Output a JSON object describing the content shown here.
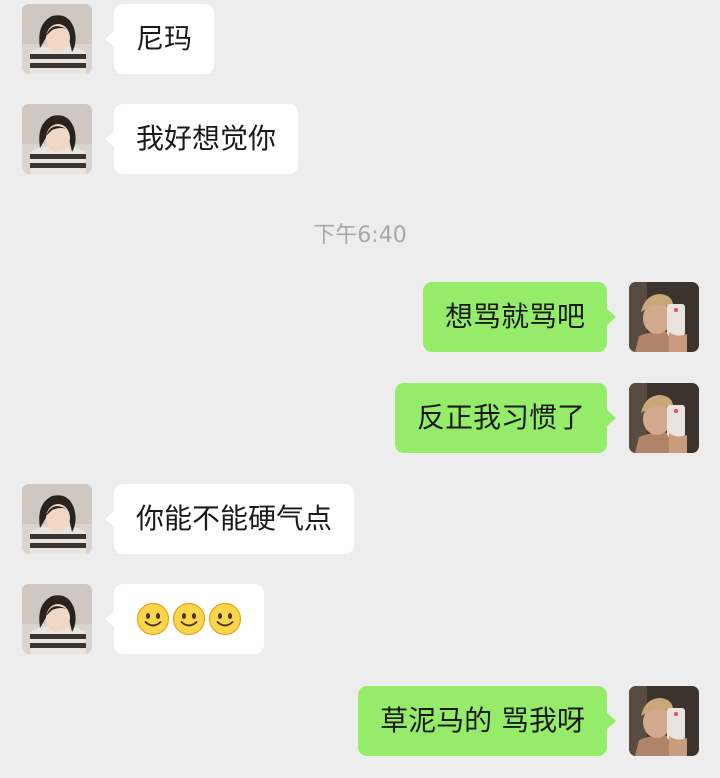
{
  "conversation": {
    "timestamp": "下午6:40",
    "messages": [
      {
        "sender": "contact",
        "text": "尼玛"
      },
      {
        "sender": "contact",
        "text": "我好想觉你"
      },
      {
        "sender": "me",
        "text": "想骂就骂吧"
      },
      {
        "sender": "me",
        "text": "反正我习惯了"
      },
      {
        "sender": "contact",
        "text": "你能不能硬气点"
      },
      {
        "sender": "contact",
        "text": "",
        "emoji": [
          "smile-emoji",
          "smile-emoji",
          "smile-emoji"
        ]
      },
      {
        "sender": "me",
        "text": "草泥马的  骂我呀"
      }
    ]
  },
  "colors": {
    "background": "#ededed",
    "incoming_bubble": "#ffffff",
    "outgoing_bubble": "#95ec69",
    "timestamp_text": "#a8a8a8"
  }
}
